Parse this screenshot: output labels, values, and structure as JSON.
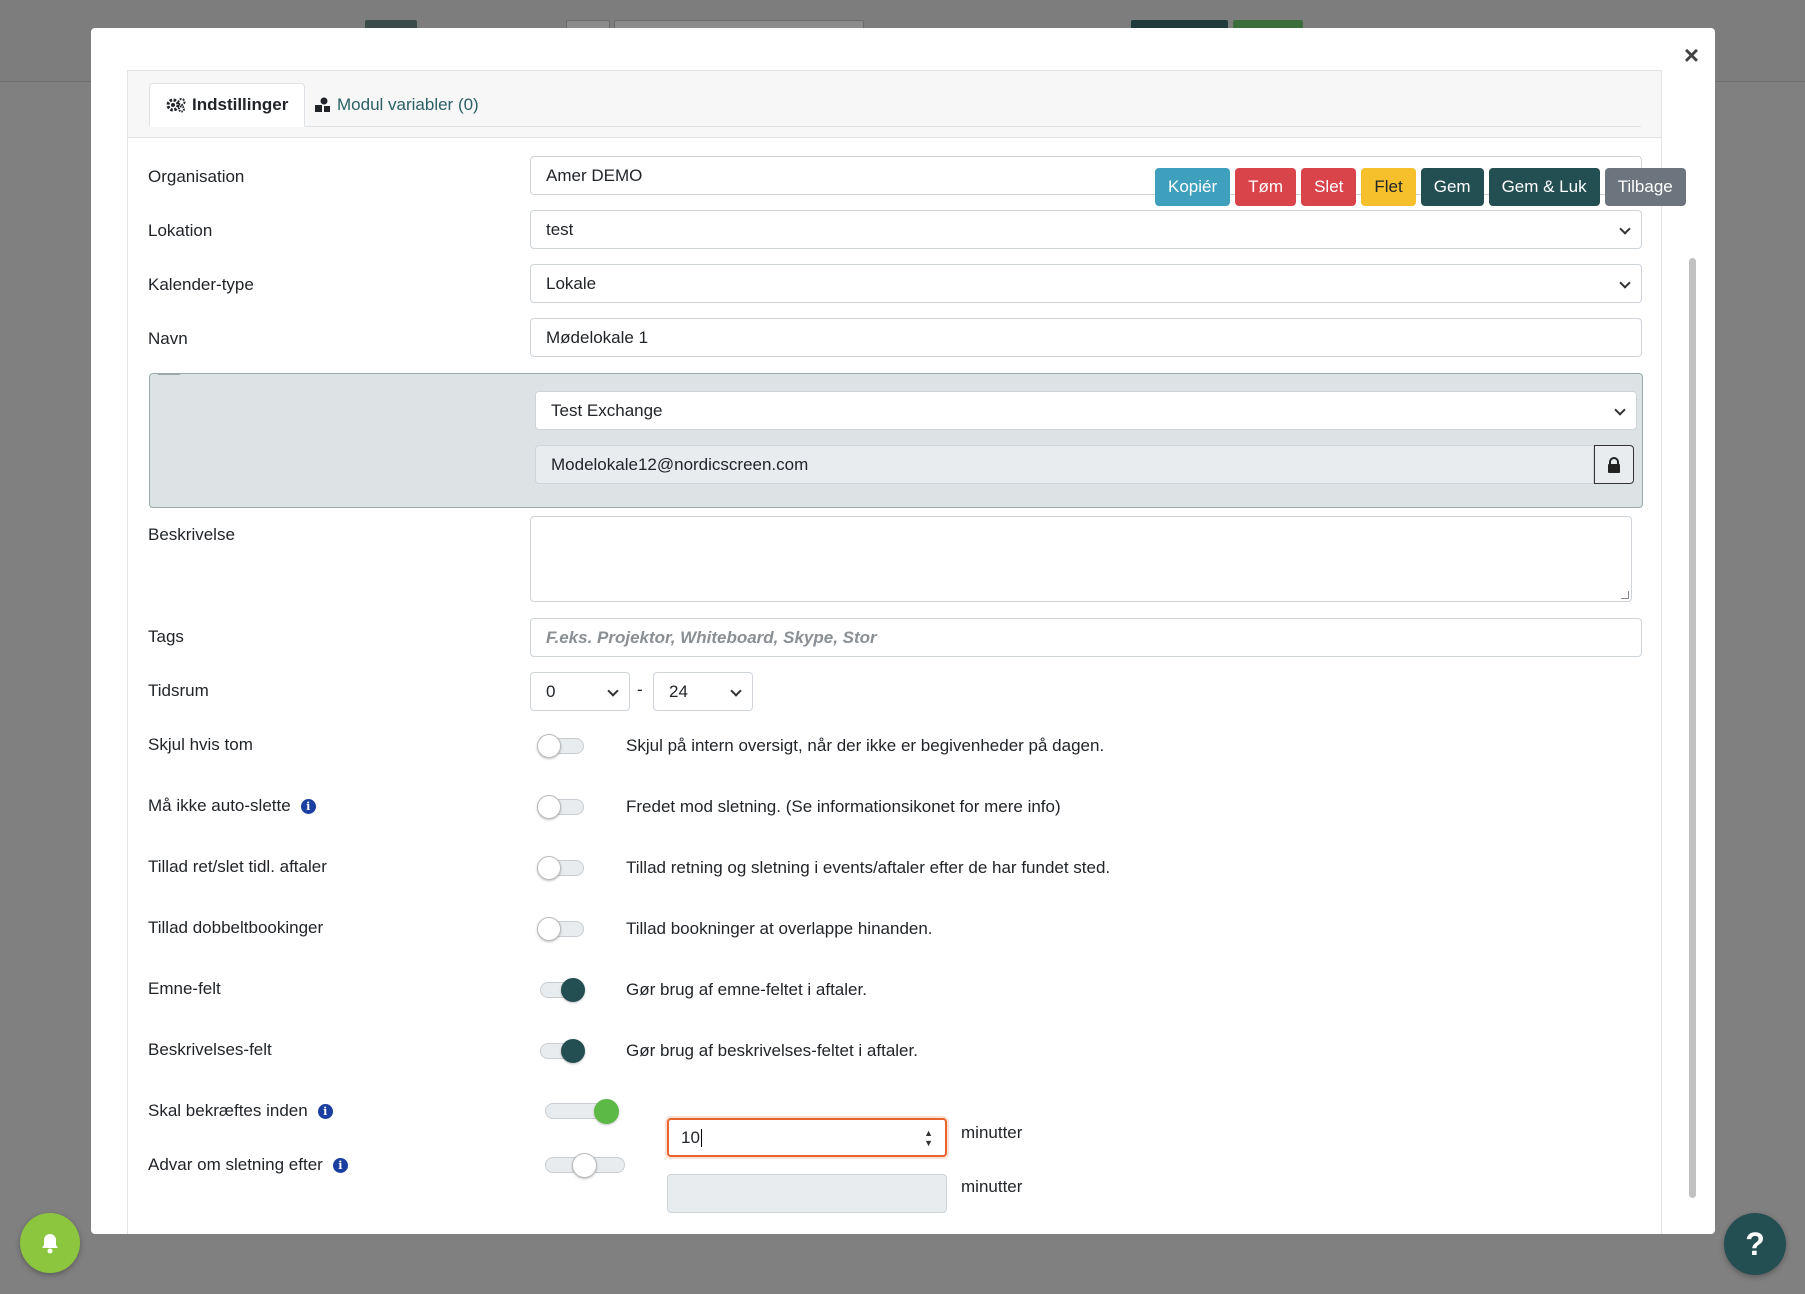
{
  "tabs": [
    {
      "label": "Indstillinger",
      "icon": "gears-icon"
    },
    {
      "label": "Modul variabler (0)",
      "icon": "shapes-icon"
    }
  ],
  "actions": {
    "copy": "Kopiér",
    "clear": "Tøm",
    "delete": "Slet",
    "merge": "Flet",
    "save": "Gem",
    "save_close": "Gem & Luk",
    "back": "Tilbage"
  },
  "fields": {
    "organisation": {
      "label": "Organisation",
      "value": "Amer DEMO"
    },
    "lokation": {
      "label": "Lokation",
      "value": "test"
    },
    "kalender_type": {
      "label": "Kalender-type",
      "value": "Lokale"
    },
    "navn": {
      "label": "Navn",
      "value": "Mødelokale 1"
    },
    "exchange": {
      "account": "Test Exchange",
      "email": "Modelokale12@nordicscreen.com"
    },
    "beskrivelse": {
      "label": "Beskrivelse",
      "value": ""
    },
    "tags": {
      "label": "Tags",
      "placeholder": "F.eks. Projektor, Whiteboard, Skype, Stor"
    },
    "tidsrum": {
      "label": "Tidsrum",
      "from": "0",
      "separator": "-",
      "to": "24"
    }
  },
  "toggles": [
    {
      "label": "Skjul hvis tom",
      "desc": "Skjul på intern oversigt, når der ikke er begivenheder på dagen.",
      "on": false,
      "info": false
    },
    {
      "label": "Må ikke auto-slette",
      "desc": "Fredet mod sletning. (Se informationsikonet for mere info)",
      "on": false,
      "info": true
    },
    {
      "label": "Tillad ret/slet tidl. aftaler",
      "desc": "Tillad retning og sletning i events/aftaler efter de har fundet sted.",
      "on": false,
      "info": false
    },
    {
      "label": "Tillad dobbeltbookinger",
      "desc": "Tillad bookninger at overlappe hinanden.",
      "on": false,
      "info": false
    },
    {
      "label": "Emne-felt",
      "desc": "Gør brug af emne-feltet i aftaler.",
      "on": true,
      "info": false
    },
    {
      "label": "Beskrivelses-felt",
      "desc": "Gør brug af beskrivelses-feltet i aftaler.",
      "on": true,
      "info": false
    }
  ],
  "confirm": {
    "label": "Skal bekræftes inden",
    "value": "10",
    "unit": "minutter",
    "slider_level": 1.0
  },
  "warn": {
    "label": "Advar om sletning efter",
    "value": "",
    "unit": "minutter",
    "slider_level": 0.5
  },
  "colors": {
    "primary": "#234e52",
    "info": "#3fa0bd",
    "danger": "#d9434a",
    "warning": "#f6c02d",
    "success": "#5cb946",
    "focus": "#e8642f"
  }
}
